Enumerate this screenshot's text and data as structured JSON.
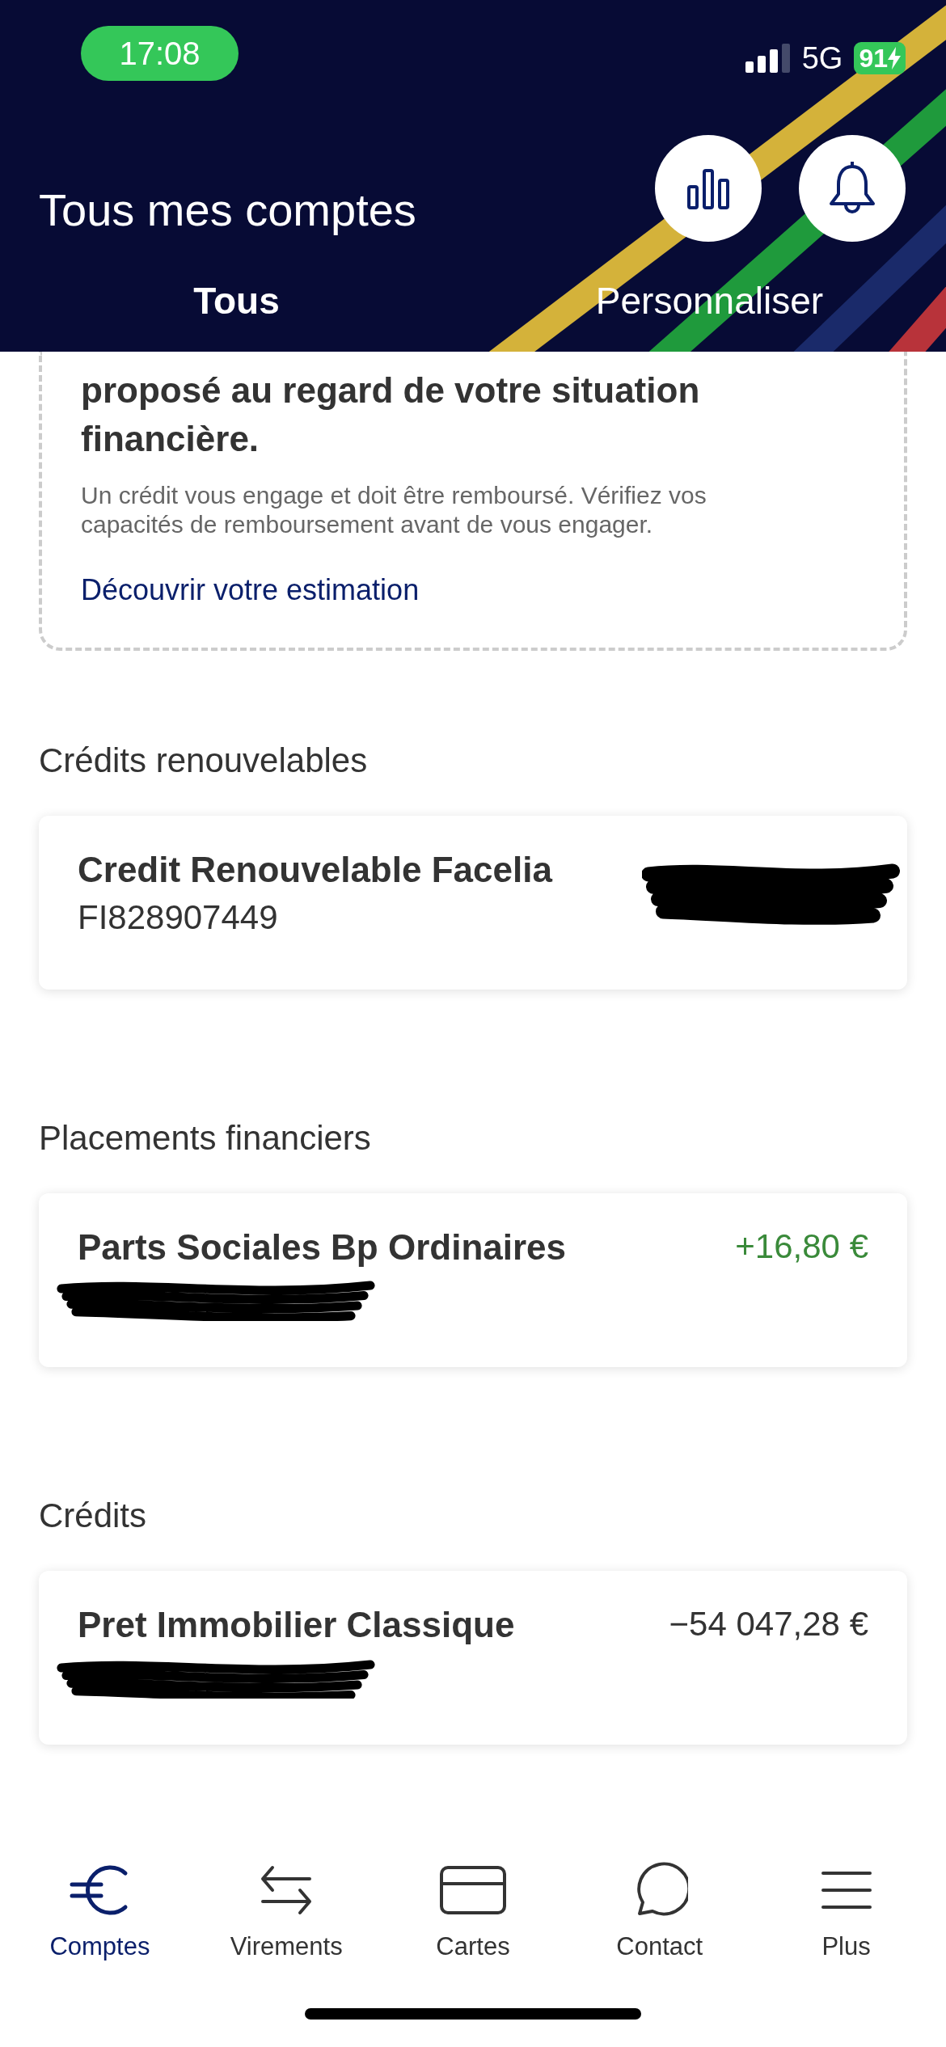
{
  "status_bar": {
    "time": "17:08",
    "network": "5G",
    "battery": "91"
  },
  "header": {
    "title": "Tous mes comptes",
    "tabs": [
      {
        "label": "Tous",
        "selected": true
      },
      {
        "label": "Personnaliser",
        "selected": false
      }
    ]
  },
  "promo_card": {
    "heading": "proposé au regard de votre situation financière.",
    "disclaimer": "Un crédit vous engage et doit être remboursé. Vérifiez vos capacités de remboursement avant de vous engager.",
    "link": "Découvrir votre estimation"
  },
  "sections": [
    {
      "title": "Crédits renouvelables",
      "accounts": [
        {
          "name": "Credit Renouvelable Facelia",
          "number": "FI828907449",
          "amount_redacted": true
        }
      ]
    },
    {
      "title": "Placements financiers",
      "accounts": [
        {
          "name": "Parts Sociales Bp Ordinaires",
          "number_redacted": true,
          "amount": "+16,80 €",
          "positive": true
        }
      ]
    },
    {
      "title": "Crédits",
      "accounts": [
        {
          "name": "Pret Immobilier Classique",
          "number_redacted": true,
          "amount": "−54 047,28 €",
          "positive": false
        }
      ]
    }
  ],
  "nav": [
    {
      "label": "Comptes",
      "selected": true
    },
    {
      "label": "Virements",
      "selected": false
    },
    {
      "label": "Cartes",
      "selected": false
    },
    {
      "label": "Contact",
      "selected": false
    },
    {
      "label": "Plus",
      "selected": false
    }
  ]
}
